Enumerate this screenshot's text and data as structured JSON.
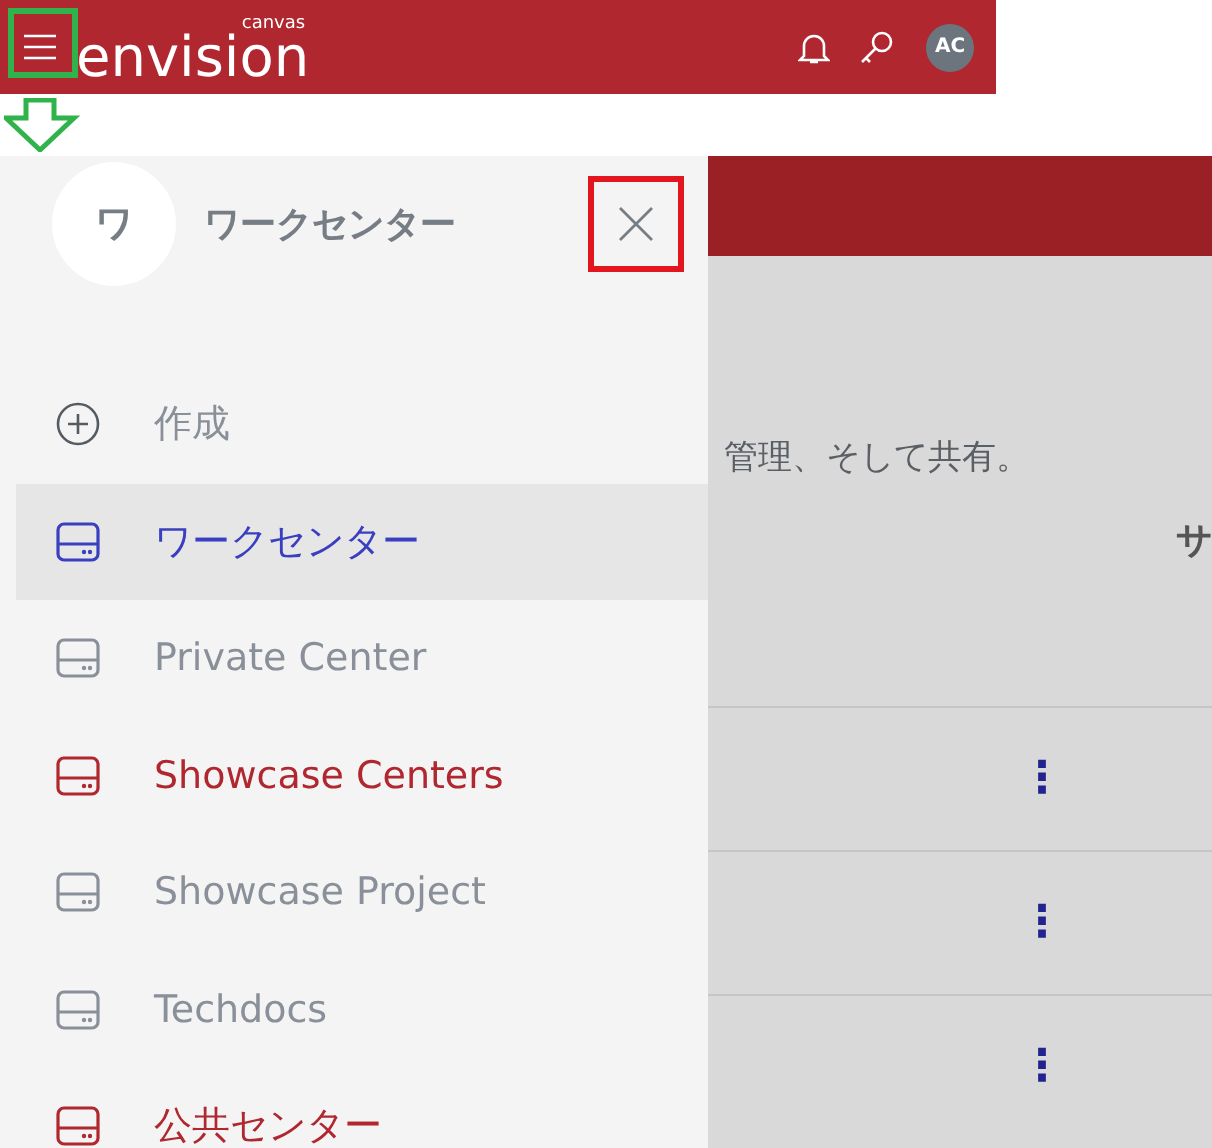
{
  "header": {
    "logo": "envision",
    "logo_sub": "canvas",
    "avatar": "AC"
  },
  "drawer": {
    "avatar": "ワ",
    "title": "ワークセンター",
    "items": [
      {
        "kind": "create",
        "label": "作成",
        "selected": false,
        "color": "#8a9099"
      },
      {
        "kind": "center",
        "label": "ワークセンター",
        "selected": true,
        "color": "#3a3fbf"
      },
      {
        "kind": "center",
        "label": "Private Center",
        "selected": false,
        "color": "#8a9099"
      },
      {
        "kind": "center",
        "label": "Showcase Centers",
        "selected": false,
        "color": "#b0272f"
      },
      {
        "kind": "center",
        "label": "Showcase Project",
        "selected": false,
        "color": "#8a9099"
      },
      {
        "kind": "center",
        "label": "Techdocs",
        "selected": false,
        "color": "#8a9099"
      },
      {
        "kind": "center",
        "label": "公共センター",
        "selected": false,
        "color": "#b0272f"
      }
    ]
  },
  "content": {
    "description": "管理、そして共有。",
    "column_header": "サ",
    "rows": [
      {
        "menu": "⋮"
      },
      {
        "menu": "⋮"
      },
      {
        "menu": "⋮"
      }
    ]
  }
}
